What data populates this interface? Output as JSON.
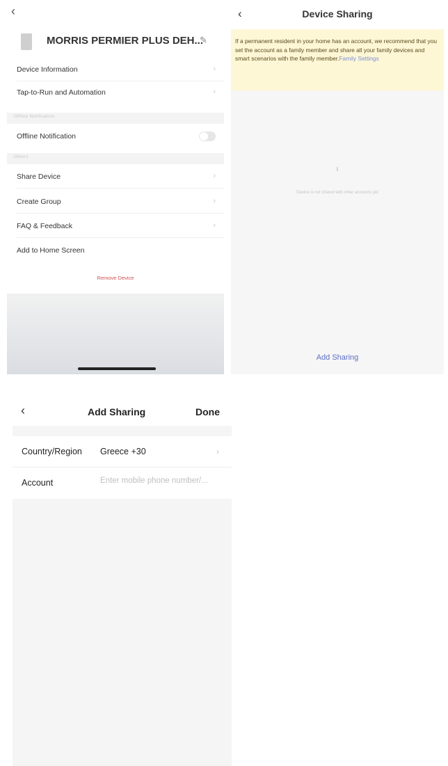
{
  "device_settings": {
    "back_icon": "chevron-left-icon",
    "device_name": "MORRIS PERMIER PLUS DEH...",
    "edit_icon": "pencil-icon",
    "rows_group1": [
      {
        "label": "Device Information"
      },
      {
        "label": "Tap-to-Run and Automation"
      }
    ],
    "section_offline": "Offline Notification",
    "offline_row": {
      "label": "Offline Notification",
      "toggle_on": false
    },
    "section_others": "Others",
    "rows_group2": [
      {
        "label": "Share Device"
      },
      {
        "label": "Create Group"
      },
      {
        "label": "FAQ & Feedback"
      },
      {
        "label": "Add to Home Screen"
      }
    ],
    "remove_label": "Remove Device"
  },
  "device_sharing": {
    "back_icon": "chevron-left-icon",
    "title": "Device Sharing",
    "banner_text": "If a permanent resident in your home has an account, we recommend that you set the account as a family member and share all your family devices and smart scenarios with the family member.",
    "banner_link": "Family Settings",
    "empty_text": "Device is not shared with other accounts yet",
    "add_button": "Add Sharing",
    "colors": {
      "banner": "#fdf7d6",
      "accent": "#5c6fc4"
    }
  },
  "add_sharing": {
    "back_icon": "chevron-left-icon",
    "title": "Add Sharing",
    "done_label": "Done",
    "country_label": "Country/Region",
    "country_value": "Greece +30",
    "account_label": "Account",
    "account_placeholder": "Enter mobile phone number/..."
  }
}
